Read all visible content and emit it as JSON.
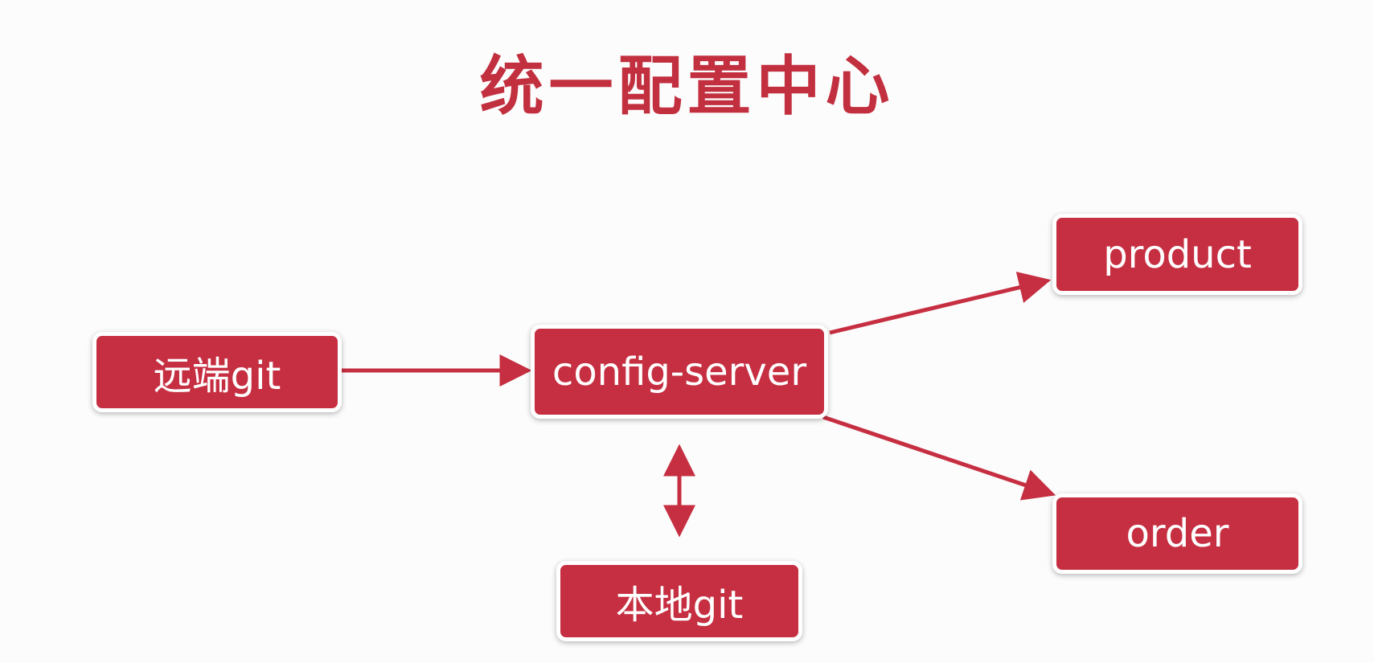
{
  "title": "统一配置中心",
  "colors": {
    "node_fill": "#c62f41",
    "title": "#c2303f",
    "arrow": "#c62f41",
    "background": "#fcfcfc"
  },
  "nodes": {
    "remote_git": "远端git",
    "config_server": "config-server",
    "local_git": "本地git",
    "product": "product",
    "order": "order"
  },
  "edges": [
    {
      "from": "remote_git",
      "to": "config_server",
      "direction": "forward"
    },
    {
      "from": "config_server",
      "to": "product",
      "direction": "forward"
    },
    {
      "from": "config_server",
      "to": "order",
      "direction": "forward"
    },
    {
      "from": "config_server",
      "to": "local_git",
      "direction": "bidirectional"
    }
  ]
}
